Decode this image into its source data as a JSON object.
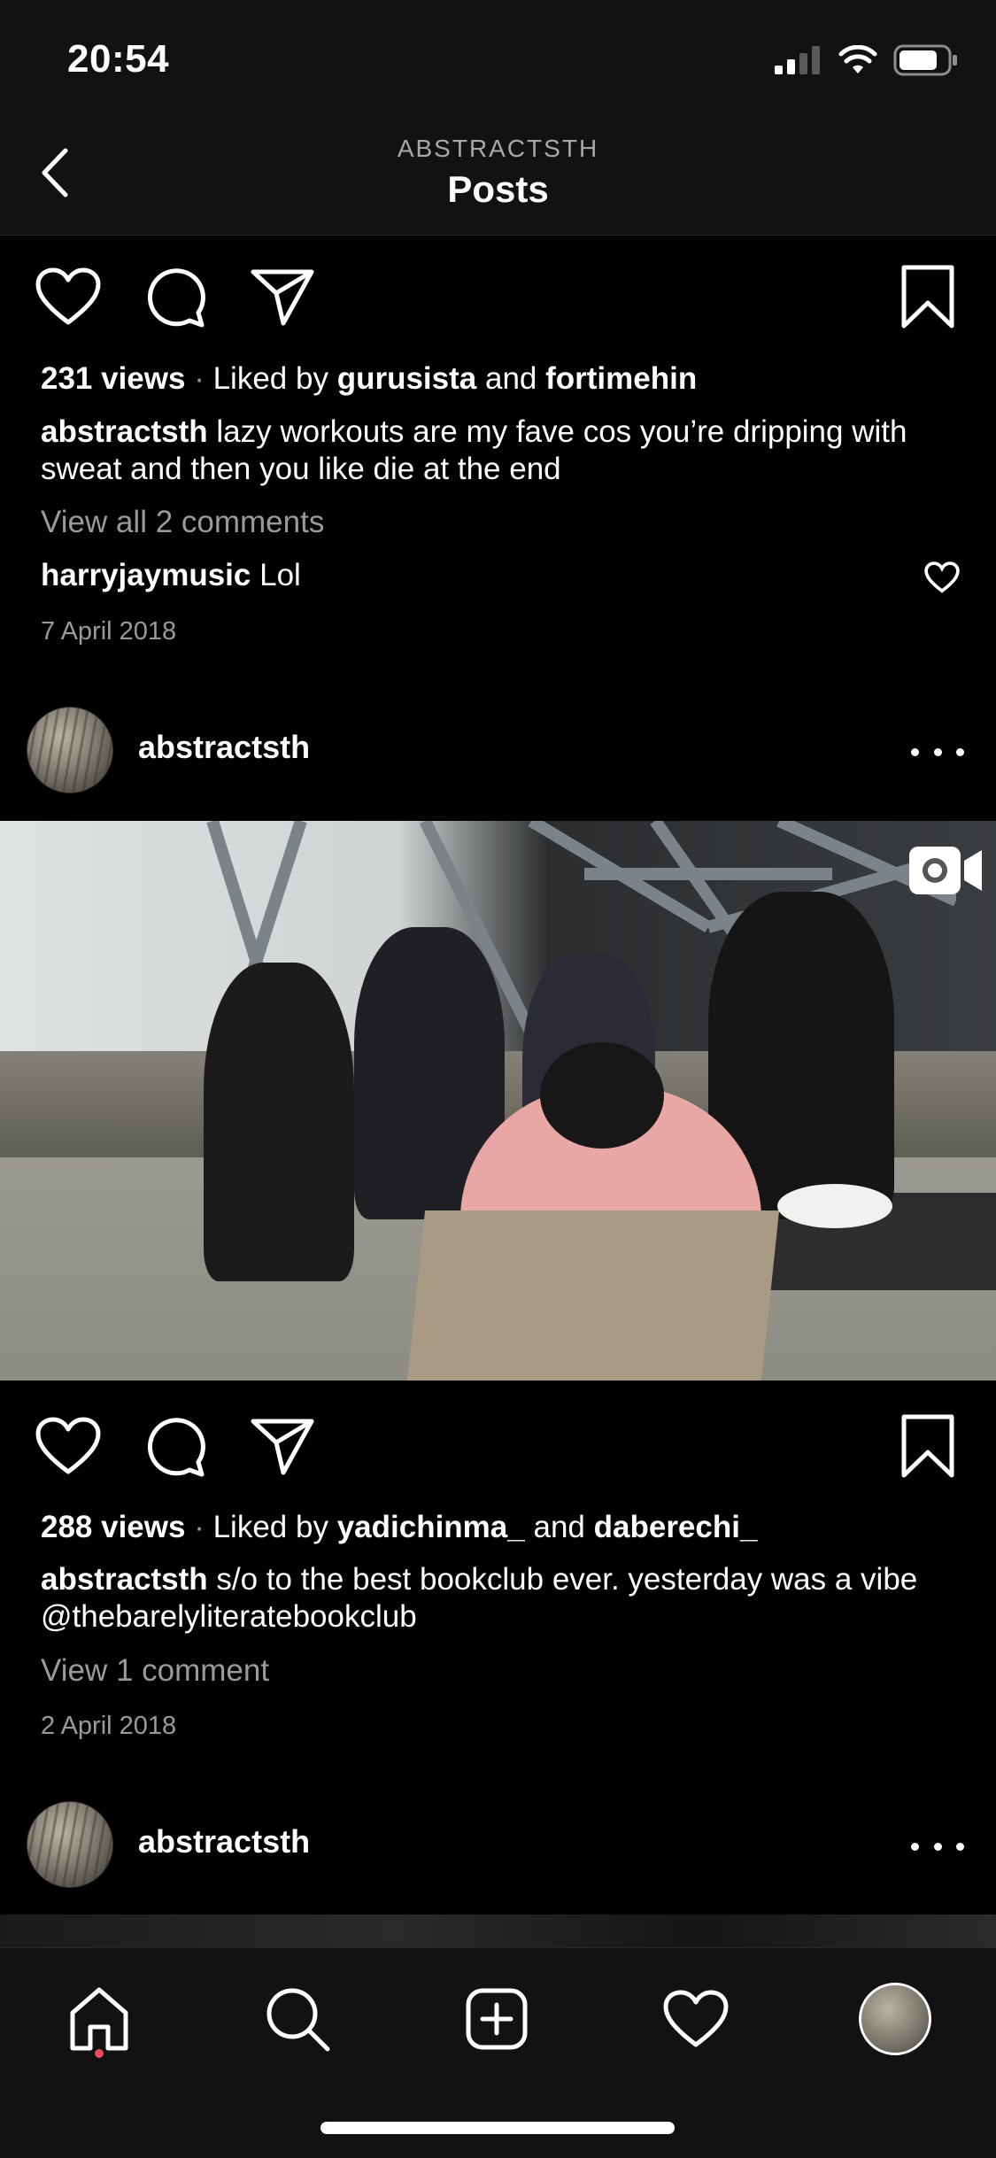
{
  "status_bar": {
    "time": "20:54"
  },
  "header": {
    "subtitle": "ABSTRACTSTH",
    "title": "Posts"
  },
  "post1": {
    "views": "231 views",
    "liked_by_prefix": "Liked by",
    "liker1": "gurusista",
    "and": "and",
    "liker2": "fortimehin",
    "caption_user": "abstractsth",
    "caption_text": "lazy workouts are my fave cos you’re dripping with sweat and then you like die at the end",
    "view_comments": "View all 2 comments",
    "comment_user": "harryjaymusic",
    "comment_text": "Lol",
    "date": "7 April 2018"
  },
  "post2": {
    "author": "abstractsth",
    "views": "288 views",
    "liked_by_prefix": "Liked by",
    "liker1": "yadichinma_",
    "and": "and",
    "liker2": "daberechi_",
    "caption_user": "abstractsth",
    "caption_text": "s/o to the best bookclub ever. yesterday was a vibe @thebarelyliteratebookclub",
    "view_comments": "View 1 comment",
    "date": "2 April 2018"
  },
  "post3": {
    "author": "abstractsth"
  },
  "icons": {
    "back": "chevron-left-icon",
    "like": "heart-icon",
    "comment": "comment-bubble-icon",
    "share": "paper-plane-icon",
    "save": "bookmark-icon",
    "more": "more-horizontal-icon",
    "video": "video-camera-icon",
    "nav": [
      "home-icon",
      "search-icon",
      "add-post-icon",
      "activity-heart-icon",
      "profile-avatar"
    ]
  },
  "colors": {
    "background": "#000000",
    "bar": "#121212",
    "muted_text": "#9a9a9a",
    "notification_dot": "#ed4956"
  }
}
